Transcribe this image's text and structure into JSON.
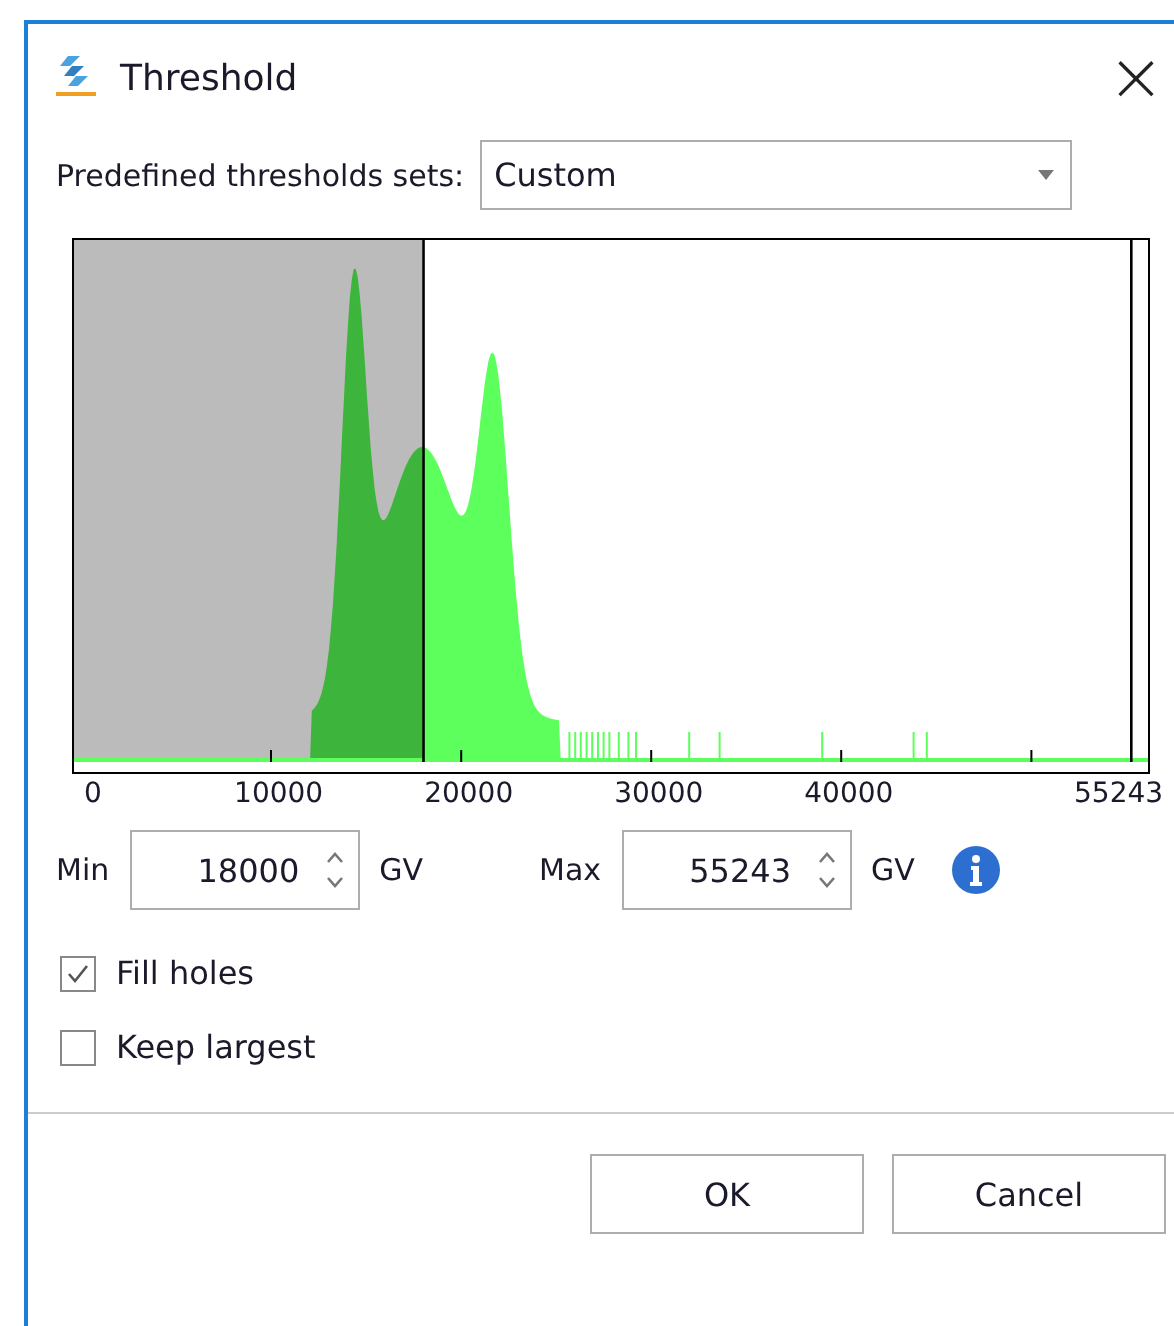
{
  "window": {
    "title": "Threshold",
    "close": "×"
  },
  "preset": {
    "label": "Predefined thresholds sets:",
    "value": "Custom"
  },
  "histogram": {
    "axis_labels": [
      "0",
      "10000",
      "20000",
      "30000",
      "40000",
      "55243"
    ]
  },
  "range": [
    {
      "label": "Min",
      "value": "18000",
      "unit": "GV"
    },
    {
      "label": "Max",
      "value": "55243",
      "unit": "GV"
    }
  ],
  "options": [
    {
      "label": "Fill holes",
      "checked": true
    },
    {
      "label": "Keep largest",
      "checked": false
    }
  ],
  "buttons": [
    "OK",
    "Cancel"
  ]
}
